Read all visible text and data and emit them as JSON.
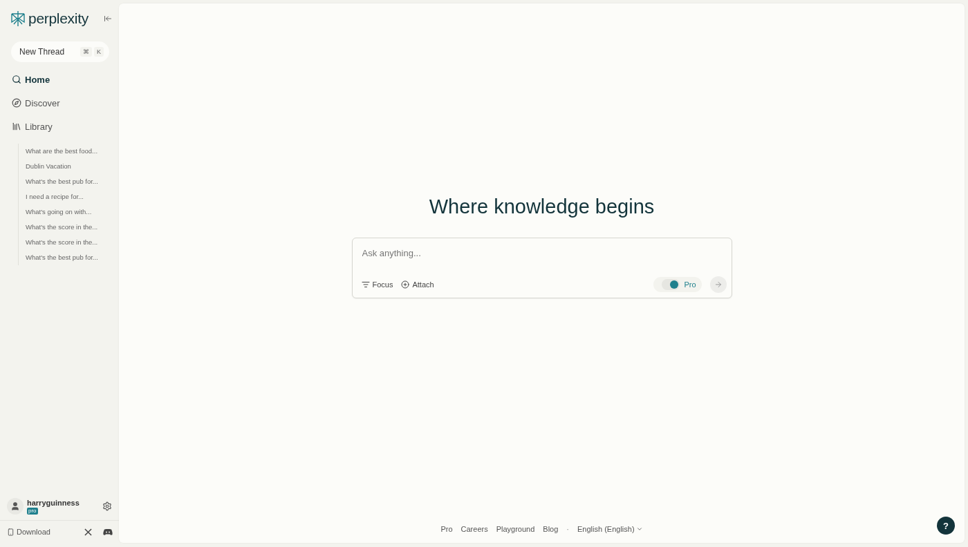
{
  "sidebar": {
    "logo": "perplexity",
    "new_thread": {
      "label": "New Thread",
      "keys": [
        "⌘",
        "K"
      ]
    },
    "nav": [
      {
        "label": "Home",
        "selected": true
      },
      {
        "label": "Discover",
        "selected": false
      },
      {
        "label": "Library",
        "selected": false
      }
    ],
    "library": [
      "What are the best food...",
      "Dublin Vacation",
      "What's the best pub for...",
      "I need a recipe for...",
      "What's going on with...",
      "What's the score in the...",
      "What's the score in the...",
      "What's the best pub for..."
    ],
    "user": {
      "name": "harryguinness",
      "badge": "pro"
    },
    "download": "Download"
  },
  "main": {
    "heading": "Where knowledge begins",
    "search": {
      "placeholder": "Ask anything...",
      "focus": "Focus",
      "attach": "Attach",
      "pro_label": "Pro",
      "pro_on": true
    },
    "footer": {
      "links": [
        "Pro",
        "Careers",
        "Playground",
        "Blog"
      ],
      "separator": "·",
      "language": "English (English)"
    },
    "help": "?"
  }
}
